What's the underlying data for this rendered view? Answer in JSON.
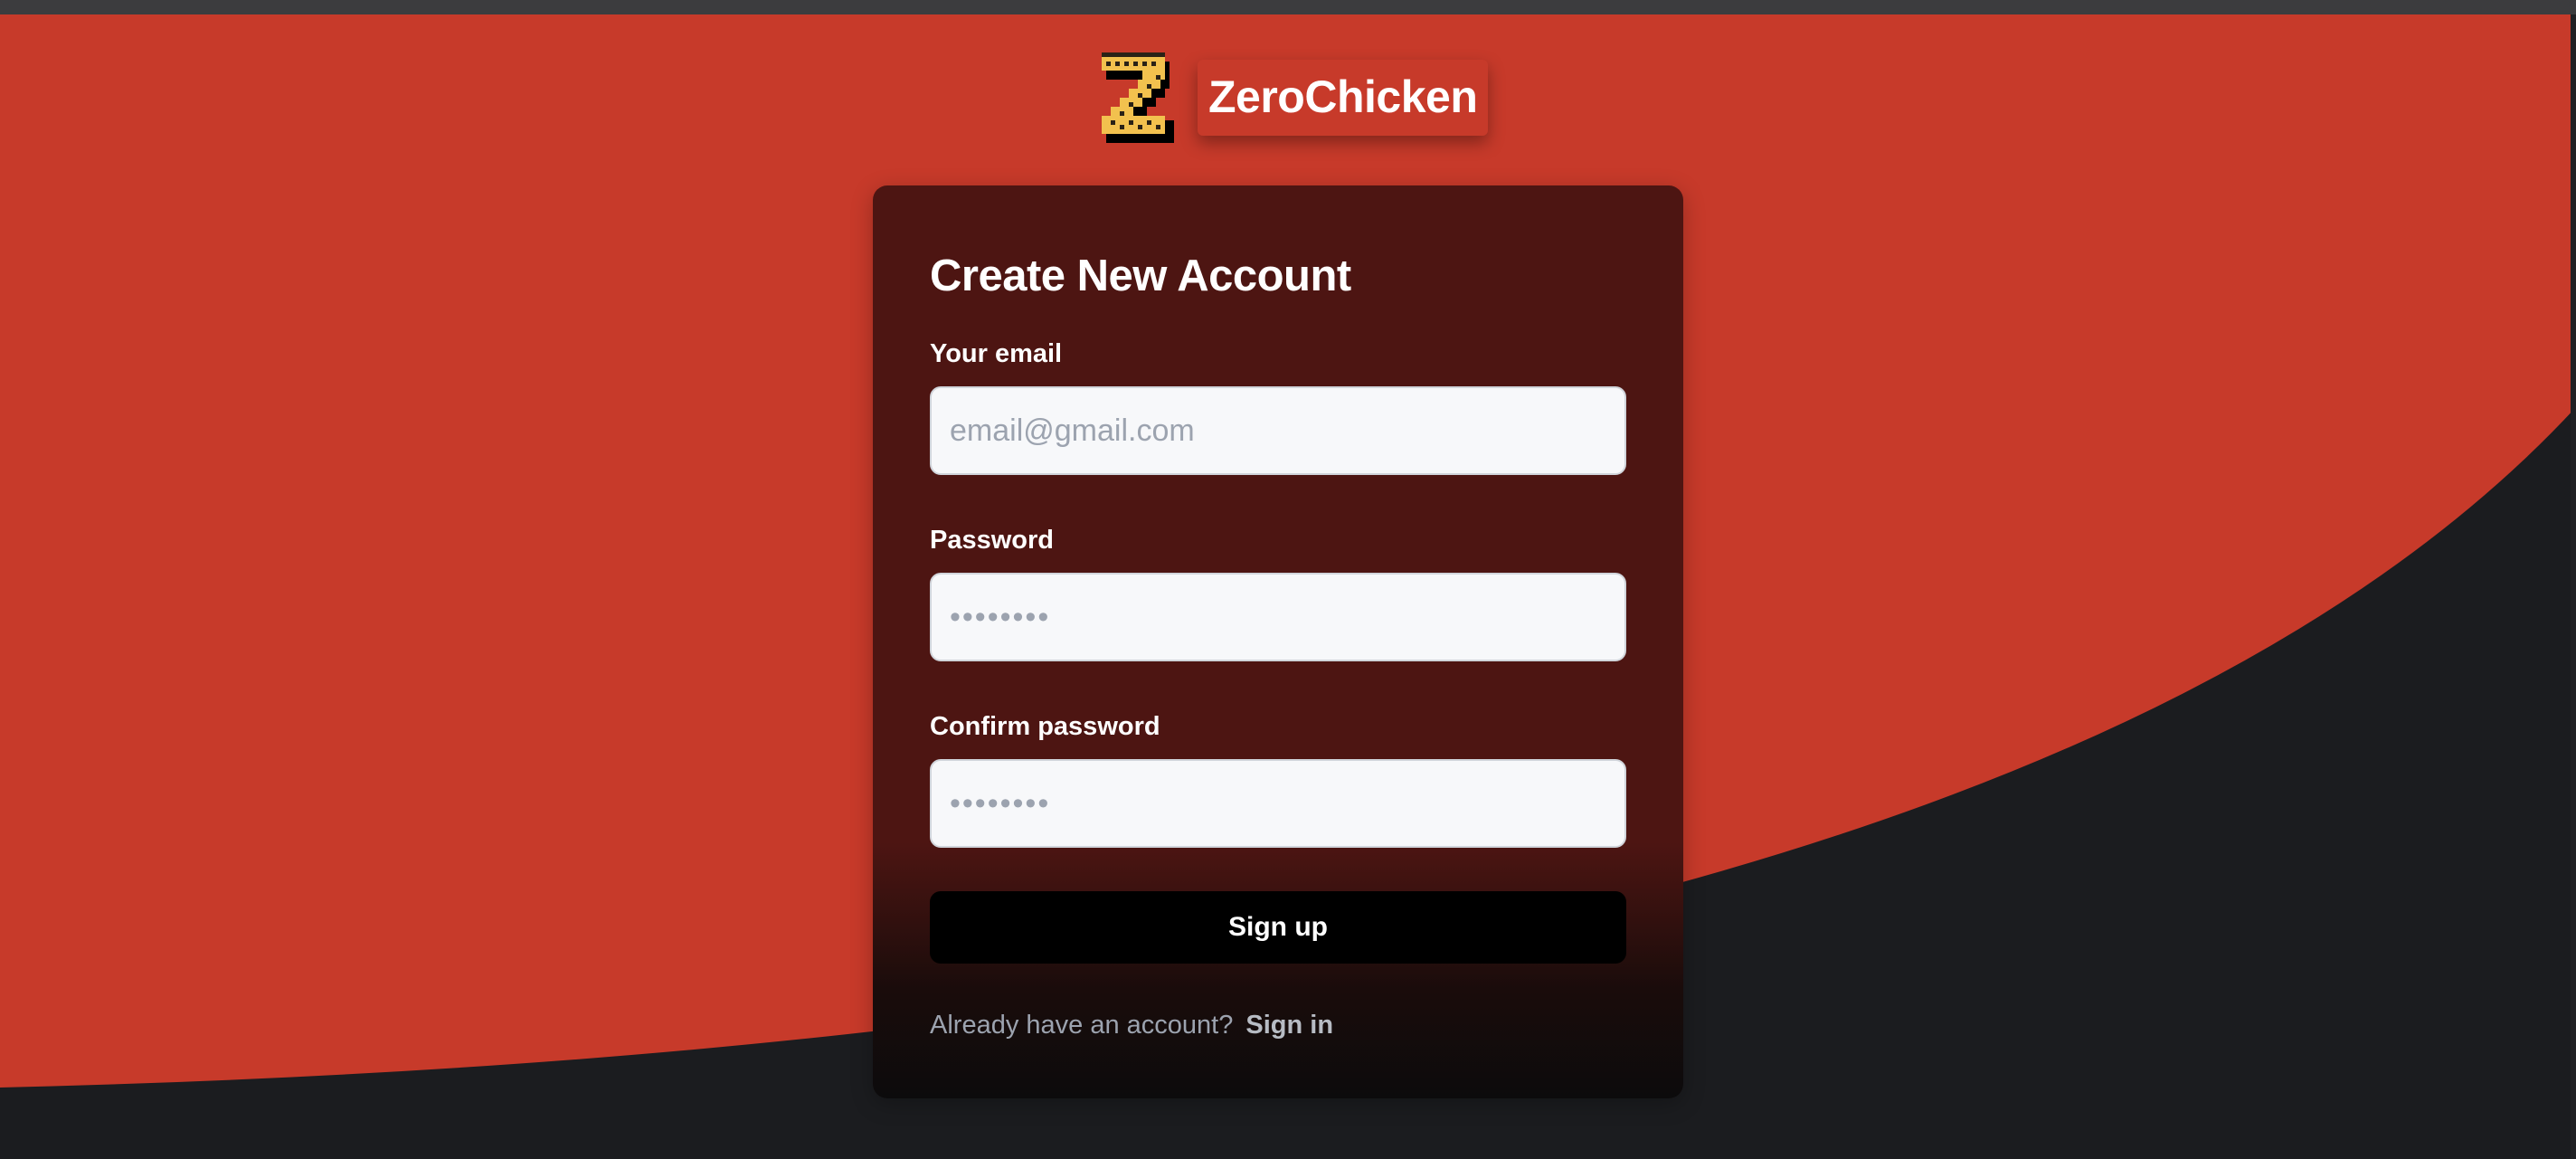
{
  "brand": {
    "logo_icon": "pixel-z-logo-icon",
    "name": "ZeroChicken"
  },
  "signup_form": {
    "title": "Create New Account",
    "email": {
      "label": "Your email",
      "placeholder": "email@gmail.com",
      "value": ""
    },
    "password": {
      "label": "Password",
      "placeholder": "••••••••",
      "value": ""
    },
    "confirm_password": {
      "label": "Confirm password",
      "placeholder": "••••••••",
      "value": ""
    },
    "submit_label": "Sign up",
    "signin_prompt": "Already have an account?",
    "signin_link": "Sign in"
  },
  "colors": {
    "background_red": "#c73a2a",
    "background_dark": "#1b1c1f",
    "card_top": "#4d1512",
    "card_bottom": "#0c0b0c",
    "button": "#000000",
    "logo_yellow": "#f2c14e"
  }
}
